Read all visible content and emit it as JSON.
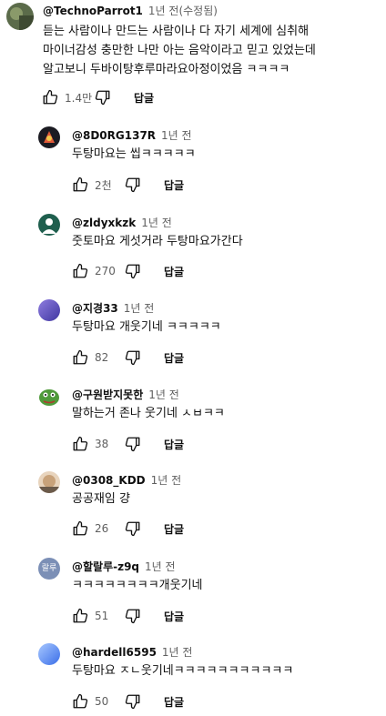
{
  "icons": {
    "like": "thumbs-up-icon",
    "dislike": "thumbs-down-icon"
  },
  "colors": {
    "avatar1": "#5b6b4a",
    "avatar2": "#1b1b22",
    "avatar3": "#1f5f4e",
    "avatar4": "#6a5ac0",
    "avatar5": "#4f9a3a",
    "avatar6": "#c8a27a",
    "avatar7": "#7b8fb6",
    "avatar8": "#5a8cf0"
  },
  "comments": [
    {
      "handle": "@TechnoParrot1",
      "time": "1년 전(수정됨)",
      "lines": [
        "듣는 사람이나 만드는 사람이나 다 자기 세계에 심취해",
        "마이너감성 충만한 나만 아는 음악이라고 믿고 있었는데",
        "알고보니 두바이탕후루마라요아정이었음 ㅋㅋㅋㅋ"
      ],
      "likes": "1.4만",
      "reply": "답글"
    },
    {
      "handle": "@8D0RG137R",
      "time": "1년 전",
      "text": "두탕마요는 씹ㅋㅋㅋㅋㅋ",
      "likes": "2천",
      "reply": "답글"
    },
    {
      "handle": "@zldyxkzk",
      "time": "1년 전",
      "text": "줏토마요 게섯거라 두탕마요가간다",
      "likes": "270",
      "reply": "답글"
    },
    {
      "handle": "@지경33",
      "time": "1년 전",
      "text": "두탕마요 개웃기네 ㅋㅋㅋㅋㅋ",
      "likes": "82",
      "reply": "답글"
    },
    {
      "handle": "@구원받지못한",
      "time": "1년 전",
      "text": "말하는거 존나 웃기네 ㅅㅂㅋㅋ",
      "likes": "38",
      "reply": "답글"
    },
    {
      "handle": "@0308_KDD",
      "time": "1년 전",
      "text": "공공재임 걍",
      "likes": "26",
      "reply": "답글"
    },
    {
      "handle": "@할랄루-z9q",
      "time": "1년 전",
      "text": "ㅋㅋㅋㅋㅋㅋㅋㅋ개웃기네",
      "likes": "51",
      "reply": "답글",
      "avatar_text": "랄루"
    },
    {
      "handle": "@hardell6595",
      "time": "1년 전",
      "text": "두탕마요 ㅈㄴ웃기네ㅋㅋㅋㅋㅋㅋㅋㅋㅋㅋㅋ",
      "likes": "50",
      "reply": "답글"
    }
  ]
}
